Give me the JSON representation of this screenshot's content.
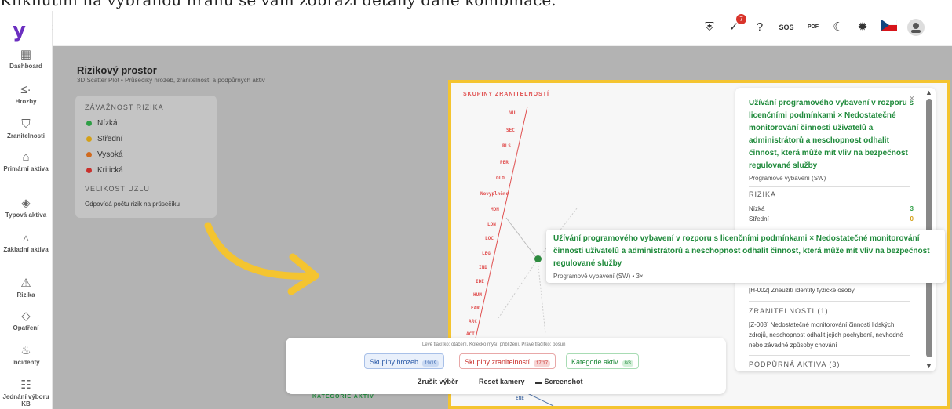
{
  "caption": "Kliknutím na vybranou hranu se vám zobrazí detaily dané kombinace.",
  "logo": "y",
  "sidebar": {
    "items": [
      {
        "label": "Dashboard",
        "icon": "dashboard-icon",
        "glyph": "▦"
      },
      {
        "label": "Hrozby",
        "icon": "megaphone-icon",
        "glyph": "📢"
      },
      {
        "label": "Zranitelnosti",
        "icon": "shield-icon",
        "glyph": "⛉"
      },
      {
        "label": "Primární aktiva",
        "icon": "building-icon",
        "glyph": "⌂"
      },
      {
        "label": "Typová aktiva",
        "icon": "tag-icon",
        "glyph": "◈"
      },
      {
        "label": "Základní aktiva",
        "icon": "shapes-icon",
        "glyph": "▵"
      },
      {
        "label": "Rizika",
        "icon": "warning-icon",
        "glyph": "⚠"
      },
      {
        "label": "Opatření",
        "icon": "bandage-icon",
        "glyph": "◇"
      },
      {
        "label": "Incidenty",
        "icon": "fire-icon",
        "glyph": "♨"
      },
      {
        "label": "Jednání výboru KB",
        "icon": "people-icon",
        "glyph": "👥"
      }
    ]
  },
  "topbar": {
    "notifications_count": "7",
    "sos_label": "SOS",
    "pdf_label": "PDF"
  },
  "page": {
    "title": "Rizikový prostor",
    "subtitle": "3D Scatter Plot • Průsečíky hrozeb, zranitelností a podpůrných aktiv"
  },
  "legend": {
    "severity_heading": "ZÁVAŽNOST RIZIKA",
    "items": [
      {
        "label": "Nízká",
        "color": "#2e9e45"
      },
      {
        "label": "Střední",
        "color": "#d4a017"
      },
      {
        "label": "Vysoká",
        "color": "#d06a1f"
      },
      {
        "label": "Kritická",
        "color": "#c9302c"
      }
    ],
    "size_heading": "VELIKOST UZLU",
    "size_text": "Odpovídá počtu rizik na průsečíku"
  },
  "plot": {
    "axis_title": "SKUPINY ZRANITELNOSTÍ",
    "axis_labels": [
      "VUL",
      "SEC",
      "RLS",
      "PER",
      "OLO",
      "Nevyplněno",
      "MON",
      "LON",
      "LOC",
      "LEG",
      "IND",
      "IDE",
      "HUM",
      "EAR",
      "ARC",
      "ACT"
    ],
    "bottom_axis_title": "KATEGORIE AKTIV",
    "bottom_axis_label": "ENE"
  },
  "detail_card": {
    "title": "Užívání programového vybavení v rozporu s licenčními podmínkami × Nedostatečné monitorování činnosti uživatelů a administrátorů a neschopnost odhalit činnost, která může mít vliv na bezpečnost regulované služby",
    "subtitle": "Programové vybavení (SW)",
    "risks_heading": "RIZIKA",
    "risks": [
      {
        "label": "Nízká",
        "value": "3",
        "color": "#2e9e45"
      },
      {
        "label": "Střední",
        "value": "0",
        "color": "#d4a017"
      }
    ],
    "threat_item": "[H-002] Zneužití identity fyzické osoby",
    "vuln_heading": "ZRANITELNOSTI (1)",
    "vuln_item": "[Z-008] Nedostatečné monitorování činnosti lidských zdrojů, neschopnost odhalit jejich pochybení, nevhodné nebo závadné způsoby chování",
    "assets_heading": "PODPŮRNÁ AKTIVA (3)"
  },
  "hover_tooltip": {
    "title": "Užívání programového vybavení v rozporu s licenčními podmínkami × Nedostatečné monitorování činnosti uživatelů a administrátorů a neschopnost odhalit činnost, která může mít vliv na bezpečnost regulované služby",
    "subtitle": "Programové vybavení (SW) • 3×"
  },
  "controls": {
    "hint": "Levé tlačítko: otáčení, Kolečko myši: přiblížení, Pravé tlačítko: posun",
    "chips": [
      {
        "label": "Skupiny hrozeb",
        "count": "19/19"
      },
      {
        "label": "Skupiny zranitelností",
        "count": "17/17"
      },
      {
        "label": "Kategorie aktiv",
        "count": "8/8"
      }
    ],
    "clear_selection": "Zrušit výběr",
    "reset_camera": "Reset kamery",
    "screenshot": "Screenshot"
  }
}
